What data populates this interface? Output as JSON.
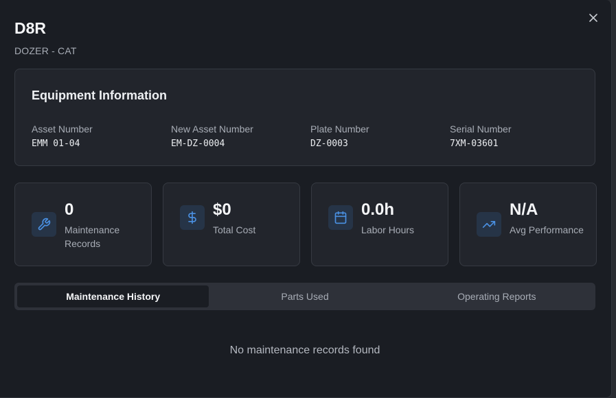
{
  "header": {
    "title": "D8R",
    "subtitle": "DOZER - CAT"
  },
  "equipment_info": {
    "heading": "Equipment Information",
    "fields": [
      {
        "label": "Asset Number",
        "value": "EMM 01-04"
      },
      {
        "label": "New Asset Number",
        "value": "EM-DZ-0004"
      },
      {
        "label": "Plate Number",
        "value": "DZ-0003"
      },
      {
        "label": "Serial Number",
        "value": "7XM-03601"
      }
    ]
  },
  "stats": [
    {
      "value": "0",
      "label": "Maintenance Records",
      "icon": "wrench-icon"
    },
    {
      "value": "$0",
      "label": "Total Cost",
      "icon": "dollar-icon"
    },
    {
      "value": "0.0h",
      "label": "Labor Hours",
      "icon": "calendar-icon"
    },
    {
      "value": "N/A",
      "label": "Avg Performance",
      "icon": "trending-up-icon"
    }
  ],
  "tabs": [
    {
      "label": "Maintenance History",
      "active": true
    },
    {
      "label": "Parts Used",
      "active": false
    },
    {
      "label": "Operating Reports",
      "active": false
    }
  ],
  "empty_state": "No maintenance records found",
  "colors": {
    "accent": "#3b82f6",
    "modal_bg": "#1a1d23",
    "card_bg": "#22252c"
  }
}
